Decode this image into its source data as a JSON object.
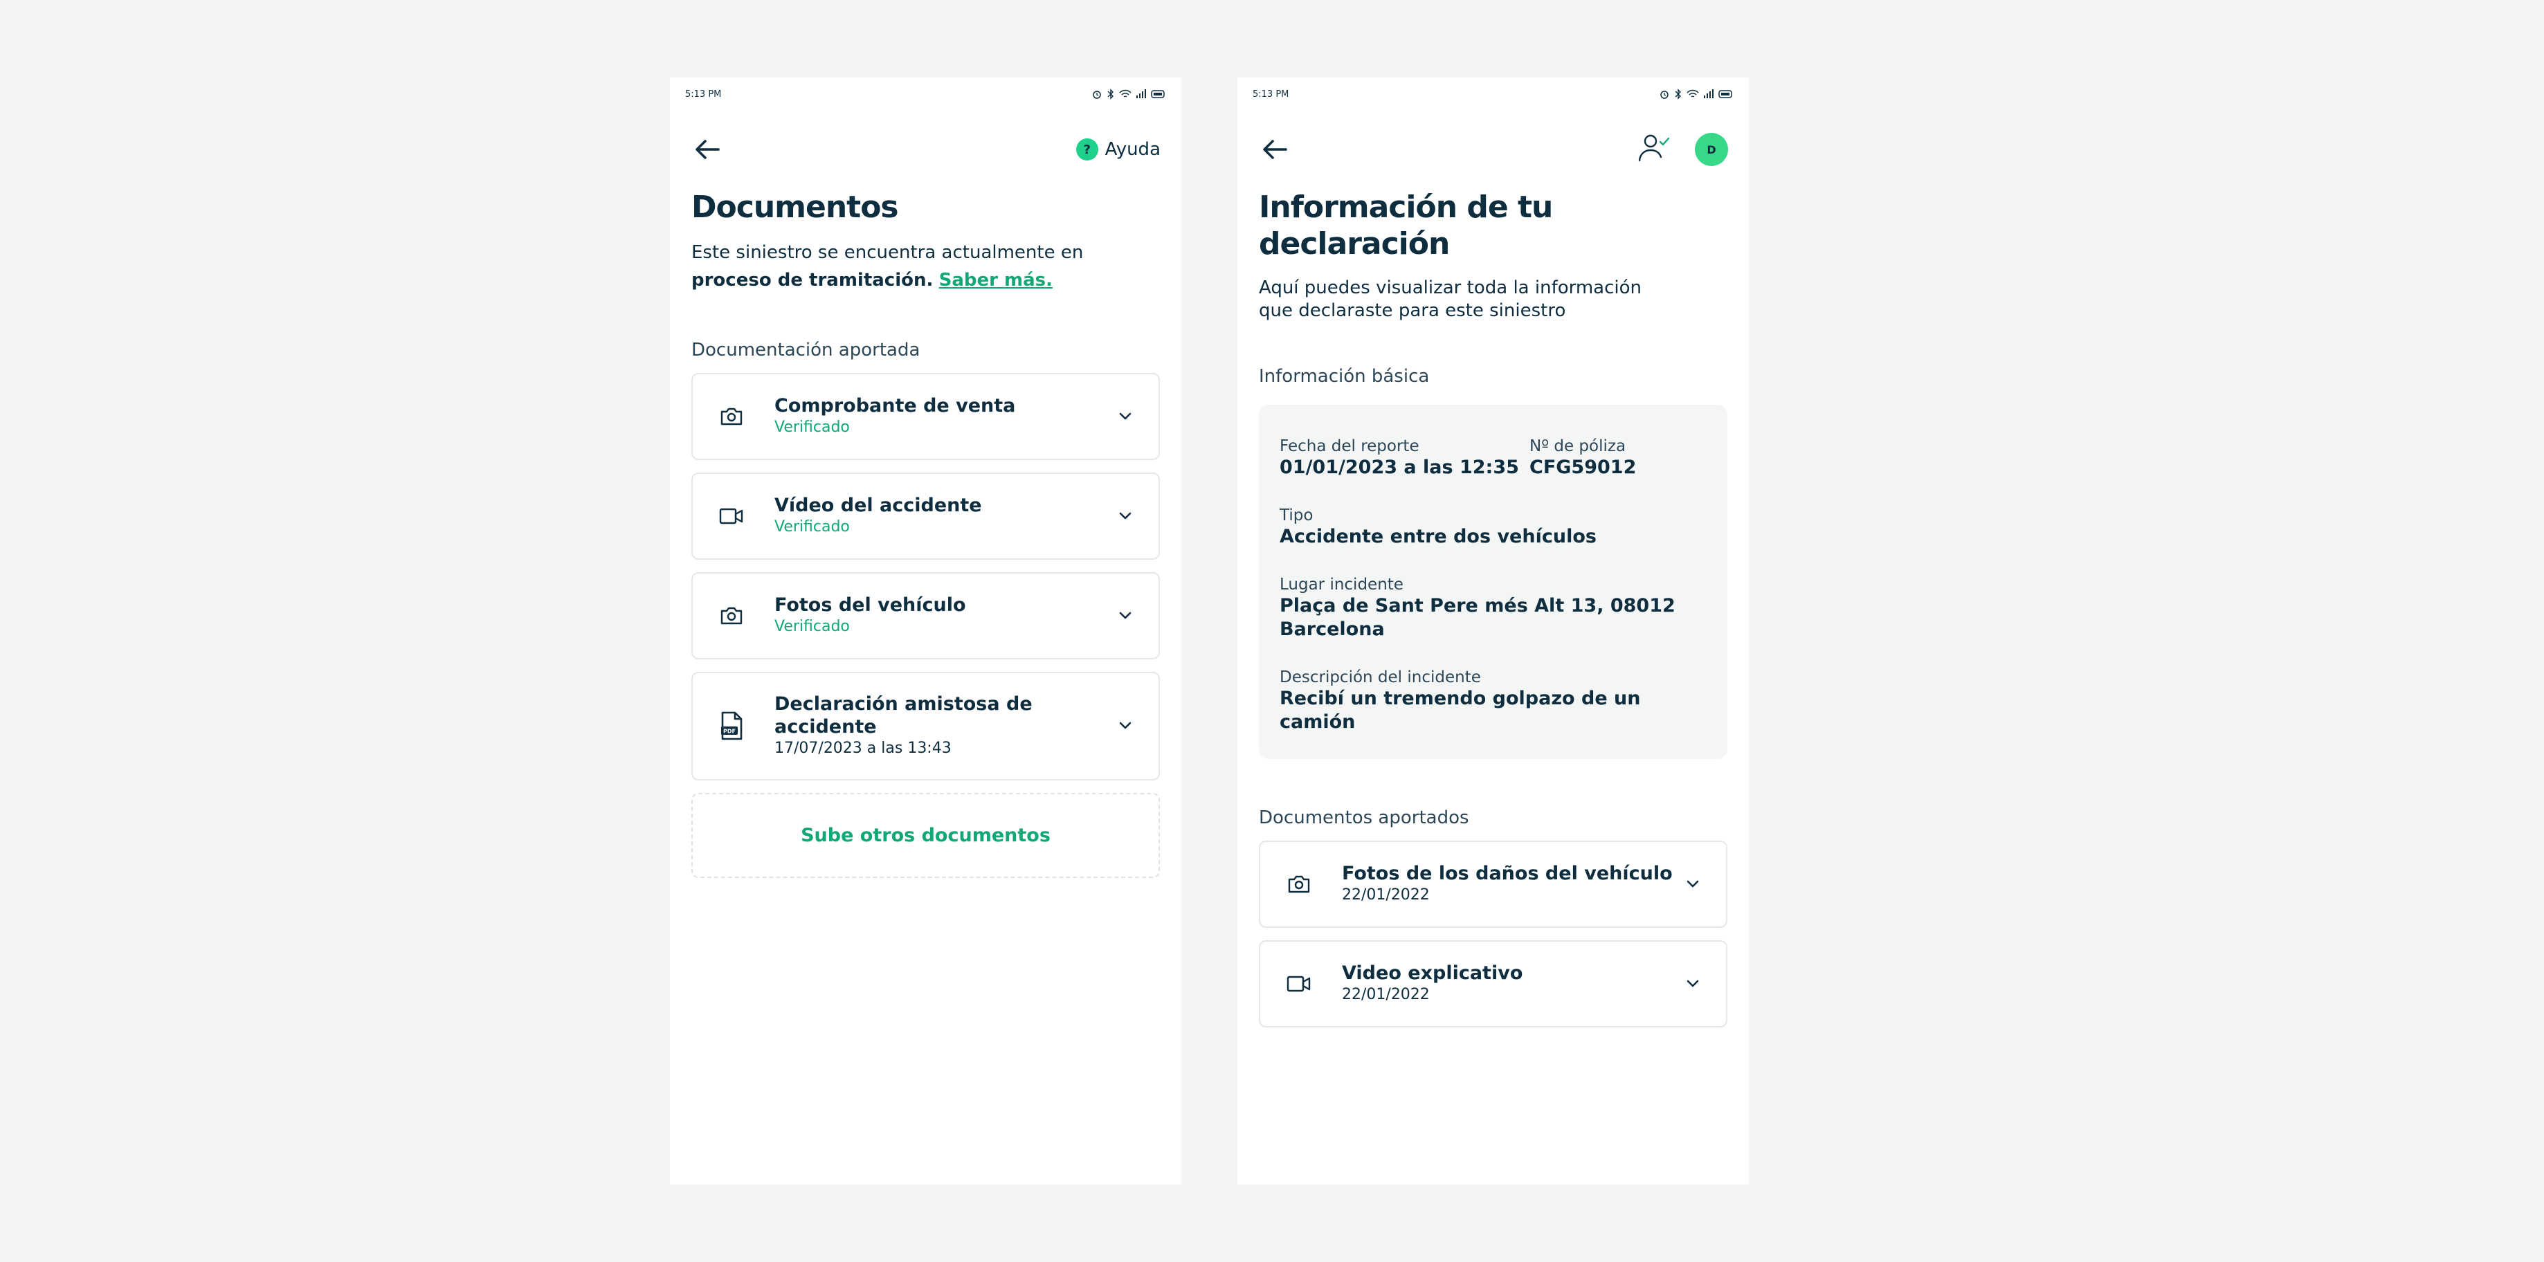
{
  "left": {
    "status_time": "5:13 PM",
    "help_label": "Ayuda",
    "help_symbol": "?",
    "title": "Documentos",
    "intro_prefix": "Este siniestro se encuentra actualmente en ",
    "intro_bold": "proceso de tramitación.",
    "intro_link": "Saber más.",
    "section_label": "Documentación aportada",
    "documents": [
      {
        "title": "Comprobante de venta",
        "subtitle": "Verificado",
        "icon": "camera-icon"
      },
      {
        "title": "Vídeo del accidente",
        "subtitle": "Verificado",
        "icon": "video-icon"
      },
      {
        "title": "Fotos del vehículo",
        "subtitle": "Verificado",
        "icon": "camera-icon"
      },
      {
        "title": "Declaración amistosa de accidente",
        "subtitle": "17/07/2023 a las 13:43",
        "icon": "pdf-document-icon"
      }
    ],
    "upload_label": "Sube otros documentos"
  },
  "right": {
    "status_time": "5:13 PM",
    "avatar_initial": "D",
    "title": "Información de tu declaración",
    "intro": "Aquí puedes visualizar toda la información que declaraste para este siniestro",
    "basic_info_label": "Información básica",
    "info": {
      "report_date_label": "Fecha del reporte",
      "report_date_value": "01/01/2023 a las 12:35",
      "policy_label": "Nº de póliza",
      "policy_value": "CFG59012",
      "type_label": "Tipo",
      "type_value": "Accidente entre dos vehículos",
      "place_label": "Lugar incidente",
      "place_value": "Plaça de Sant Pere més Alt 13, 08012 Barcelona",
      "description_label": "Descripción del incidente",
      "description_value": "Recibí un tremendo golpazo de un camión"
    },
    "documents_label": "Documentos aportados",
    "documents": [
      {
        "title": "Fotos de los daños del vehículo",
        "subtitle": "22/01/2022",
        "icon": "camera-icon"
      },
      {
        "title": "Video explicativo",
        "subtitle": "22/01/2022",
        "icon": "video-icon"
      }
    ]
  },
  "colors": {
    "accent": "#12a873",
    "help_badge": "#1fd08a",
    "avatar": "#38d889",
    "text": "#0e2d3f",
    "background": "#f4f4f4",
    "info_box": "#f4f5f5"
  }
}
